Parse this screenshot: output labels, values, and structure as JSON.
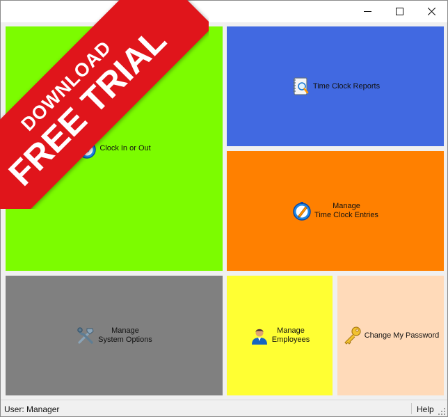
{
  "window": {
    "controls": {
      "minimize": "minimize-icon",
      "maximize": "maximize-icon",
      "close": "close-icon"
    }
  },
  "promo": {
    "line1": "DOWNLOAD",
    "line2": "FREE TRIAL",
    "color": "#e0151b"
  },
  "tiles": {
    "clock_in_out": {
      "label": "Clock In or Out",
      "color": "#7cfc00",
      "icon": "stopwatch-icon"
    },
    "time_clock_reports": {
      "label": "Time Clock Reports",
      "color": "#4169e1",
      "icon": "report-notebook-icon"
    },
    "manage_entries": {
      "line1": "Manage",
      "line2": "Time Clock Entries",
      "color": "#ff8000",
      "icon": "edit-clock-icon"
    },
    "system_options": {
      "line1": "Manage",
      "line2": "System Options",
      "color": "#808080",
      "icon": "tools-icon"
    },
    "employees": {
      "line1": "Manage",
      "line2": "Employees",
      "color": "#ffff33",
      "icon": "user-icon"
    },
    "change_password": {
      "label": "Change My Password",
      "color": "#ffdab9",
      "icon": "key-icon"
    }
  },
  "status": {
    "user": "User: Manager",
    "help": "Help"
  }
}
